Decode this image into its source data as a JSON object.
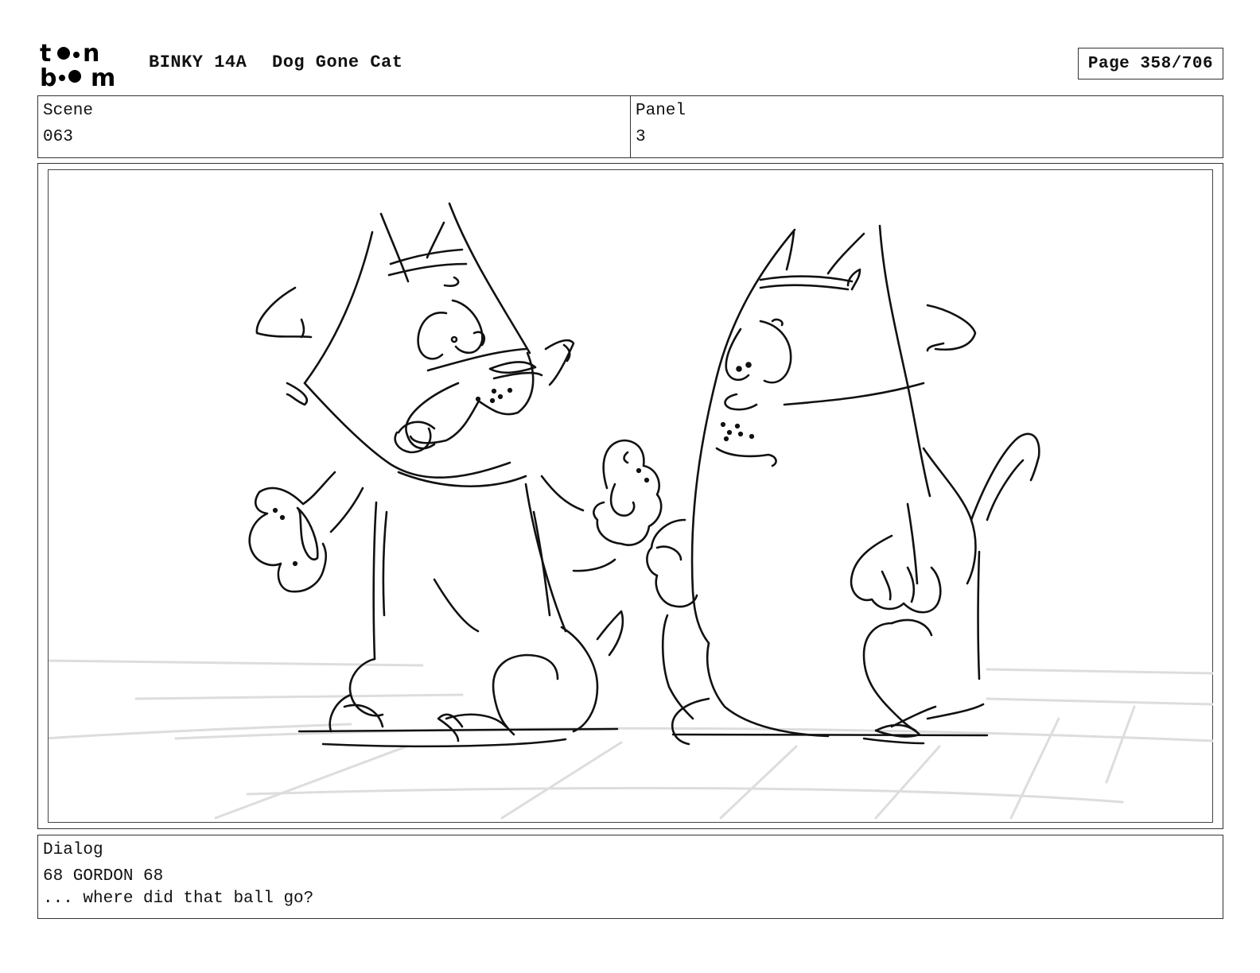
{
  "header": {
    "logo_text_top": "toon",
    "logo_text_bottom": "boom",
    "episode_code": "BINKY 14A",
    "episode_title": "Dog Gone Cat",
    "page_label": "Page 358/706"
  },
  "info": {
    "scene_label": "Scene",
    "scene_value": "063",
    "panel_label": "Panel",
    "panel_value": "3"
  },
  "dialog": {
    "label": "Dialog",
    "line1": "68 GORDON 68",
    "line2": "... where did that ball go?"
  }
}
